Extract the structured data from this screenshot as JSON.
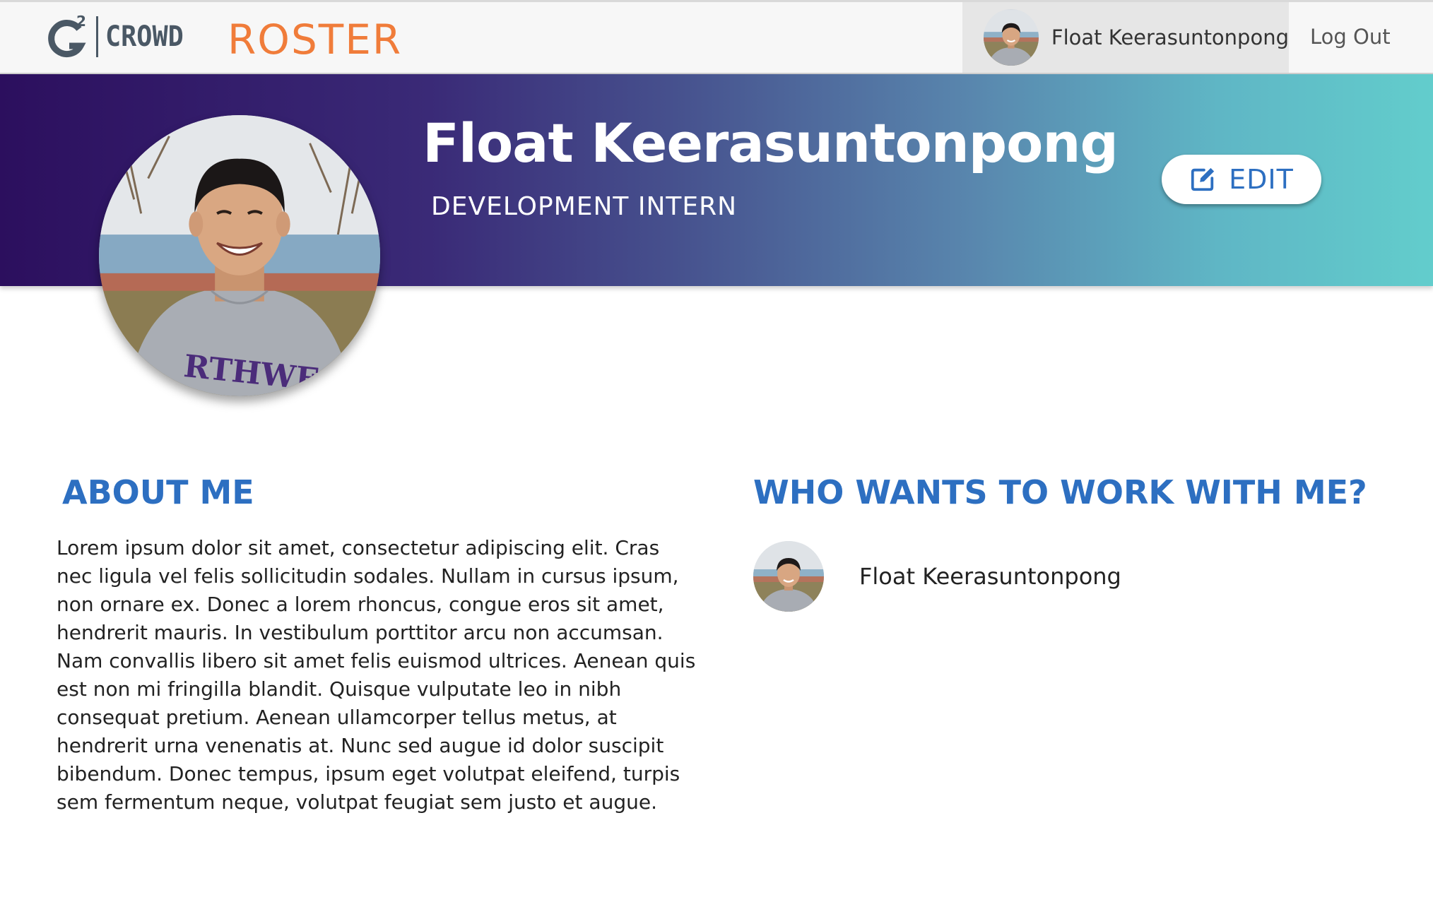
{
  "app": {
    "logo_text": "CROWD",
    "logo_mark": "G2",
    "title": "ROSTER"
  },
  "nav": {
    "user_name": "Float Keerasuntonpong",
    "logout_label": "Log Out"
  },
  "profile": {
    "name": "Float Keerasuntonpong",
    "title": "DEVELOPMENT INTERN",
    "edit_label": "EDIT"
  },
  "about": {
    "heading": "ABOUT ME",
    "text": "Lorem ipsum dolor sit amet, consectetur adipiscing elit. Cras nec ligula vel felis sollicitudin sodales. Nullam in cursus ipsum, non ornare ex. Donec a lorem rhoncus, congue eros sit amet, hendrerit mauris. In vestibulum porttitor arcu non accumsan. Nam convallis libero sit amet felis euismod ultrices. Aenean quis est non mi fringilla blandit. Quisque vulputate leo in nibh consequat pretium. Aenean ullamcorper tellus metus, at hendrerit urna venenatis at. Nunc sed augue id dolor suscipit bibendum. Donec tempus, ipsum eget volutpat eleifend, turpis sem fermentum neque, volutpat feugiat sem justo et augue."
  },
  "collaborators": {
    "heading": "WHO WANTS TO WORK WITH ME?",
    "items": [
      {
        "name": "Float Keerasuntonpong"
      }
    ]
  },
  "colors": {
    "brand_orange": "#f07c3a",
    "heading_blue": "#2d6fc1",
    "banner_start": "#2c0f5e",
    "banner_end": "#62cdcc"
  }
}
